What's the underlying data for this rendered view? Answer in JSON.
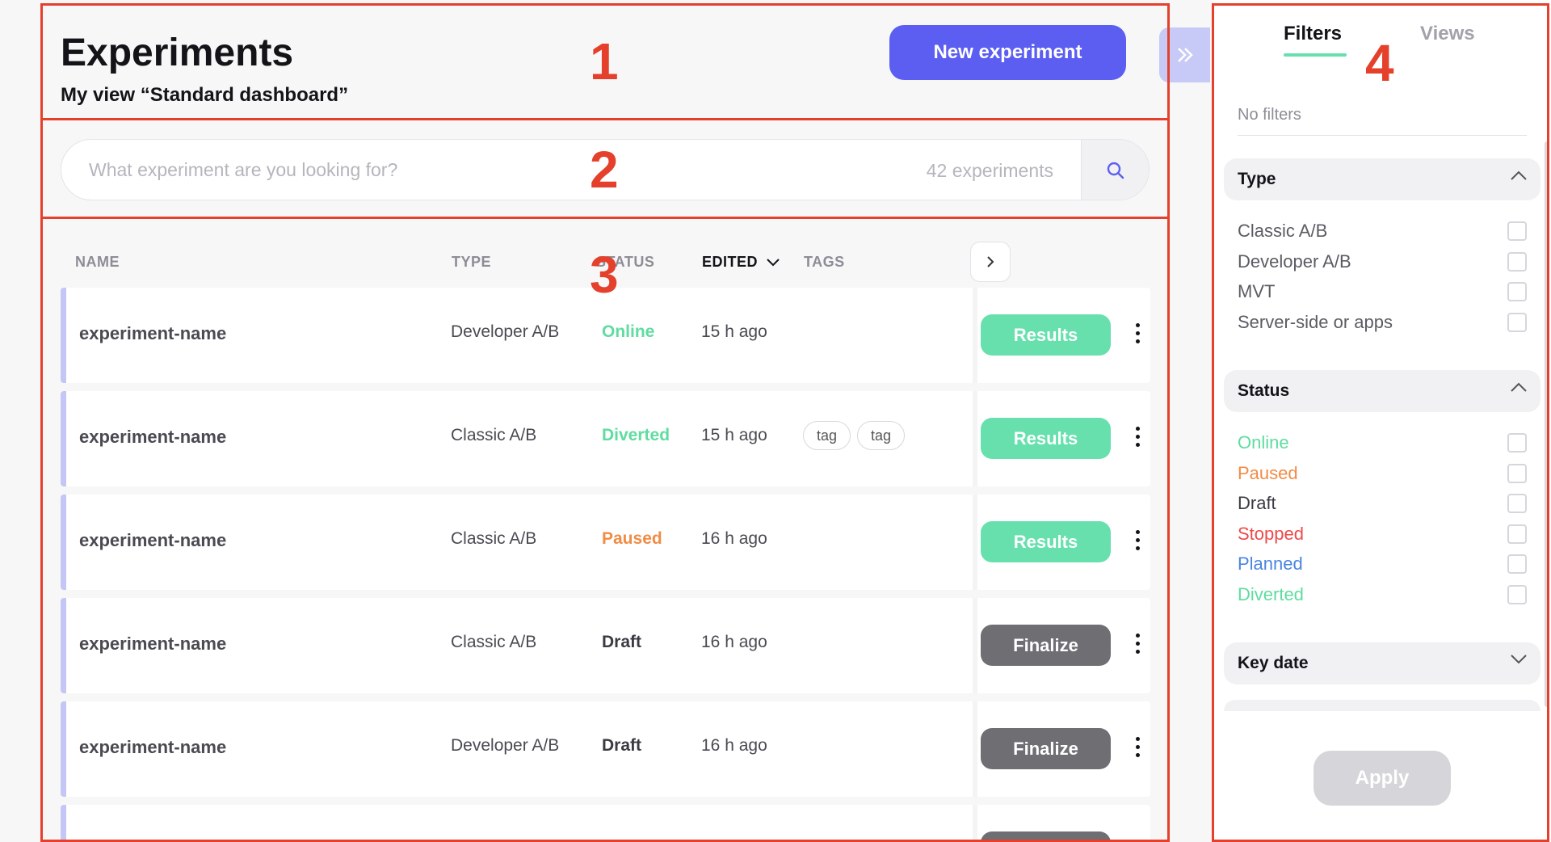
{
  "header": {
    "title": "Experiments",
    "subtitle": "My view “Standard dashboard”",
    "new_button_label": "New experiment"
  },
  "search": {
    "placeholder": "What experiment are you looking for?",
    "count_label": "42 experiments"
  },
  "table": {
    "columns": {
      "name": "NAME",
      "type": "TYPE",
      "status": "STATUS",
      "edited": "EDITED",
      "tags": "TAGS"
    },
    "sorted_column": "EDITED",
    "rows": [
      {
        "name": "experiment-name",
        "type": "Developer A/B",
        "status": "Online",
        "status_color": "#5fdca0",
        "edited": "15 h ago",
        "tags": [],
        "action": "Results"
      },
      {
        "name": "experiment-name",
        "type": "Classic A/B",
        "status": "Diverted",
        "status_color": "#5fdca0",
        "edited": "15 h ago",
        "tags": [
          "tag",
          "tag"
        ],
        "action": "Results"
      },
      {
        "name": "experiment-name",
        "type": "Classic A/B",
        "status": "Paused",
        "status_color": "#f08c45",
        "edited": "16 h ago",
        "tags": [],
        "action": "Results"
      },
      {
        "name": "experiment-name",
        "type": "Classic A/B",
        "status": "Draft",
        "status_color": "#3a3a42",
        "edited": "16 h ago",
        "tags": [],
        "action": "Finalize"
      },
      {
        "name": "experiment-name",
        "type": "Developer A/B",
        "status": "Draft",
        "status_color": "#3a3a42",
        "edited": "16 h ago",
        "tags": [],
        "action": "Finalize"
      }
    ]
  },
  "panel": {
    "tabs": [
      "Filters",
      "Views"
    ],
    "active_tab": "Filters",
    "no_filters": "No filters",
    "sections": [
      {
        "title": "Type",
        "expanded": true,
        "options": [
          {
            "label": "Classic A/B",
            "color": "#5b5b63"
          },
          {
            "label": "Developer A/B",
            "color": "#5b5b63"
          },
          {
            "label": "MVT",
            "color": "#5b5b63"
          },
          {
            "label": "Server-side or apps",
            "color": "#5b5b63"
          }
        ]
      },
      {
        "title": "Status",
        "expanded": true,
        "options": [
          {
            "label": "Online",
            "color": "#5fdca0"
          },
          {
            "label": "Paused",
            "color": "#f08c45"
          },
          {
            "label": "Draft",
            "color": "#3a3a42"
          },
          {
            "label": "Stopped",
            "color": "#ee4a4a"
          },
          {
            "label": "Planned",
            "color": "#4a84e0"
          },
          {
            "label": "Diverted",
            "color": "#5fdca0"
          }
        ]
      },
      {
        "title": "Key date",
        "expanded": false,
        "options": []
      }
    ],
    "apply_label": "Apply"
  },
  "annotations": [
    "1",
    "2",
    "3",
    "4"
  ],
  "colors": {
    "accent": "#5b5ef0",
    "results": "#67e0ae",
    "finalize": "#6e6e73",
    "annotation": "#e4402b"
  }
}
